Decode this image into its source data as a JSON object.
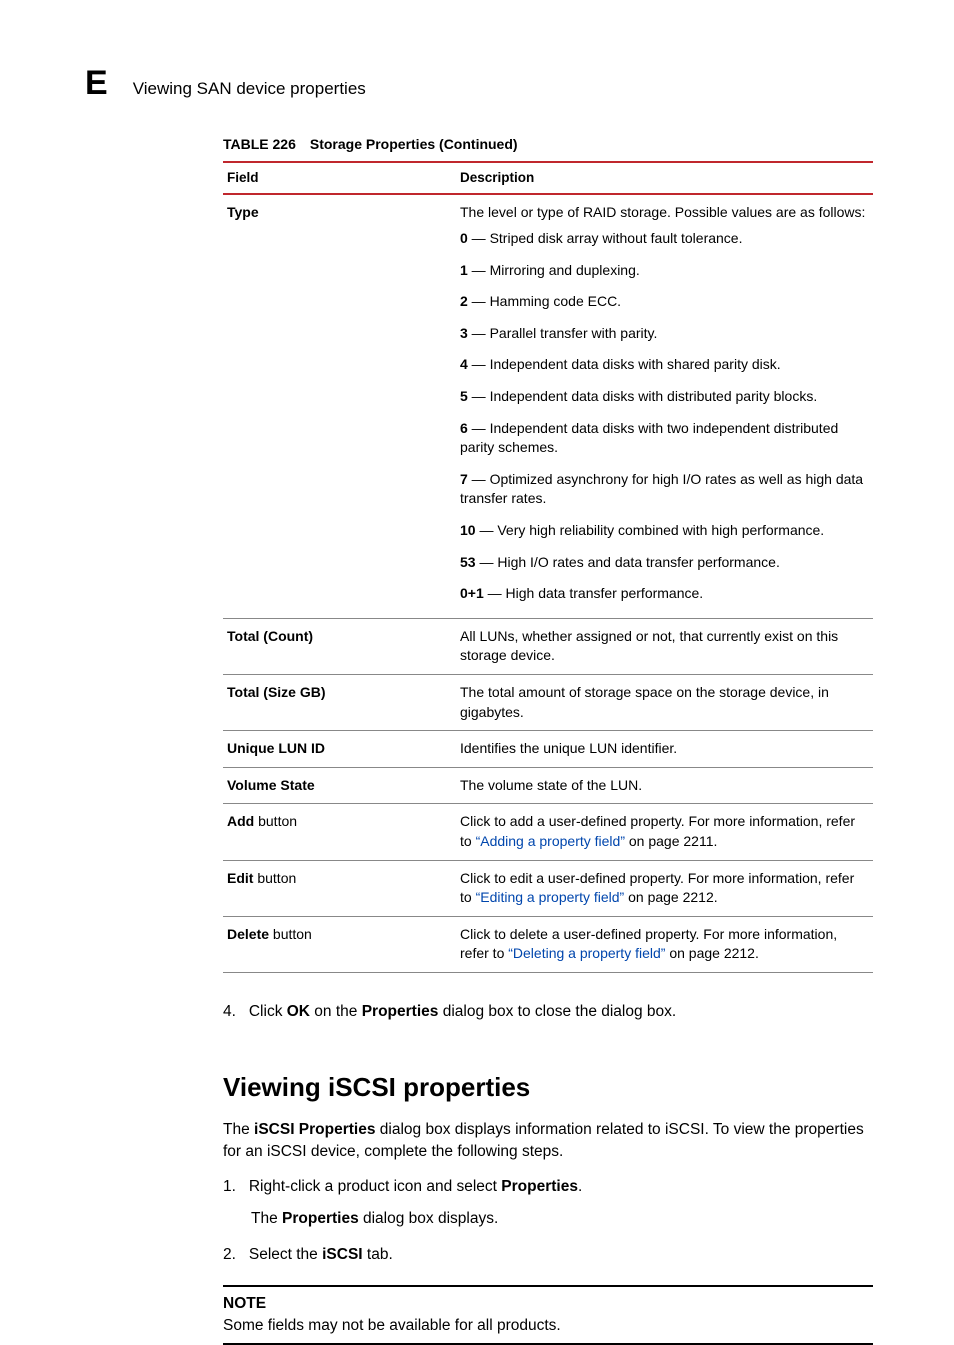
{
  "header": {
    "appendix_letter": "E",
    "running": "Viewing SAN device properties"
  },
  "table": {
    "label": "TABLE 226",
    "title": "Storage Properties (Continued)",
    "col_field": "Field",
    "col_desc": "Description",
    "rows": {
      "type": {
        "field": "Type",
        "lead": "The level or type of RAID storage. Possible values are as follows:",
        "items": [
          {
            "k": "0",
            "v": " — Striped disk array without fault tolerance."
          },
          {
            "k": "1",
            "v": " — Mirroring and duplexing."
          },
          {
            "k": "2",
            "v": " — Hamming code ECC."
          },
          {
            "k": "3",
            "v": " — Parallel transfer with parity."
          },
          {
            "k": "4",
            "v": " — Independent data disks with shared parity disk."
          },
          {
            "k": "5",
            "v": " — Independent data disks with distributed parity blocks."
          },
          {
            "k": "6",
            "v": " — Independent data disks with two independent distributed parity schemes."
          },
          {
            "k": "7",
            "v": " — Optimized asynchrony for high I/O rates as well as high data transfer rates."
          },
          {
            "k": "10",
            "v": " — Very high reliability combined with high performance."
          },
          {
            "k": "53",
            "v": " — High I/O rates and data transfer performance."
          },
          {
            "k": "0+1",
            "v": " — High data transfer performance."
          }
        ]
      },
      "total_count": {
        "field": "Total (Count)",
        "desc": "All LUNs, whether assigned or not, that currently exist on this storage device."
      },
      "total_size": {
        "field": "Total (Size GB)",
        "desc": "The total amount of storage space on the storage device, in gigabytes."
      },
      "lun_id": {
        "field": "Unique LUN ID",
        "desc": "Identifies the unique LUN identifier."
      },
      "vol_state": {
        "field": "Volume State",
        "desc": "The volume state of the LUN."
      },
      "add": {
        "field_b": "Add",
        "field_r": " button",
        "pre": "Click to add a user-defined property. For more information, refer to ",
        "link": "“Adding a property field”",
        "post": " on page 2211."
      },
      "edit": {
        "field_b": "Edit",
        "field_r": " button",
        "pre": "Click to edit a user-defined property. For more information, refer to ",
        "link": "“Editing a property field”",
        "post": " on page 2212."
      },
      "delete": {
        "field_b": "Delete",
        "field_r": " button",
        "pre": "Click to delete a user-defined property. For more information, refer to ",
        "link": "“Deleting a property field”",
        "post": " on page 2212."
      }
    }
  },
  "step4": {
    "num": "4.",
    "pre": "Click ",
    "b1": "OK",
    "mid": " on the ",
    "b2": "Properties",
    "post": " dialog box to close the dialog box."
  },
  "iscsi": {
    "heading": "Viewing iSCSI properties",
    "intro_pre": "The ",
    "intro_b": "iSCSI Properties",
    "intro_post": " dialog box displays information related to iSCSI. To view the properties for an iSCSI device, complete the following steps.",
    "s1_num": "1.",
    "s1_pre": "Right-click a product icon and select ",
    "s1_b": "Properties",
    "s1_post": ".",
    "s1_sub_pre": "The ",
    "s1_sub_b": "Properties",
    "s1_sub_post": " dialog box displays.",
    "s2_num": "2.",
    "s2_pre": "Select the ",
    "s2_b": "iSCSI",
    "s2_post": " tab."
  },
  "note": {
    "label": "NOTE",
    "text": "Some fields may not be available for all products."
  }
}
